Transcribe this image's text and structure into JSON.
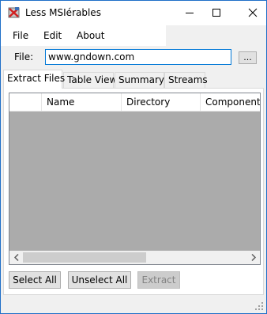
{
  "window": {
    "title": "Less MSIérables",
    "accent_color": "#1f6fc8"
  },
  "menu": {
    "file": "File",
    "edit": "Edit",
    "about": "About"
  },
  "file_row": {
    "label": "File:",
    "value": "www.gndown.com",
    "browse_label": "..."
  },
  "tabs": [
    {
      "label": "Extract Files",
      "active": true
    },
    {
      "label": "Table View",
      "active": false
    },
    {
      "label": "Summary",
      "active": false
    },
    {
      "label": "Streams",
      "active": false
    }
  ],
  "list": {
    "columns": [
      "",
      "Name",
      "Directory",
      "Component"
    ],
    "rows": []
  },
  "buttons": {
    "select_all": "Select All",
    "unselect_all": "Unselect All",
    "extract": "Extract"
  },
  "icons": {
    "app": "msi-app-icon",
    "minimize": "minimize-icon",
    "maximize": "maximize-icon",
    "close": "close-icon",
    "scroll_left": "chevron-left-icon",
    "scroll_right": "chevron-right-icon",
    "grip": "resize-grip-icon"
  }
}
